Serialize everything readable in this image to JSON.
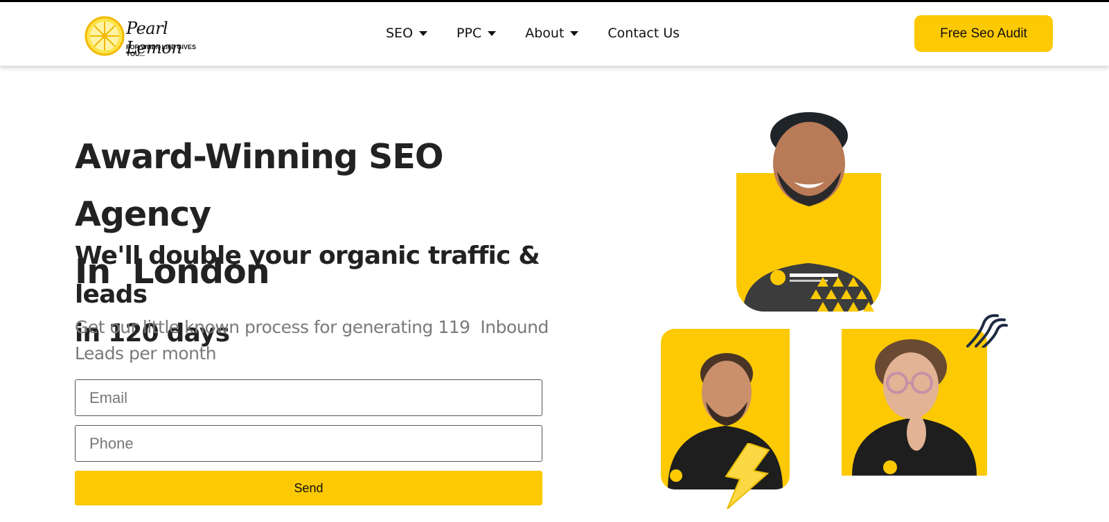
{
  "brand": {
    "name": "Pearl Lemon",
    "tagline": "FOR WHEN LIFE GIVES YOU..."
  },
  "nav": {
    "items": [
      {
        "label": "SEO",
        "has_dropdown": true
      },
      {
        "label": "PPC",
        "has_dropdown": true
      },
      {
        "label": "About",
        "has_dropdown": true
      },
      {
        "label": "Contact Us",
        "has_dropdown": false
      }
    ],
    "cta_label": "Free Seo Audit"
  },
  "hero": {
    "title_line1": "Award-Winning SEO Agency",
    "title_line2": "In  London",
    "subtitle_line1": "We'll double your organic traffic & leads",
    "subtitle_line2": "in 120 days",
    "desc_line1": "Get our little known process for generating 119  Inbound",
    "desc_line2": "Leads per month"
  },
  "form": {
    "email_placeholder": "Email",
    "phone_placeholder": "Phone",
    "send_label": "Send"
  },
  "colors": {
    "accent": "#fcc903",
    "text": "#222222",
    "muted": "#7a7a7a"
  }
}
